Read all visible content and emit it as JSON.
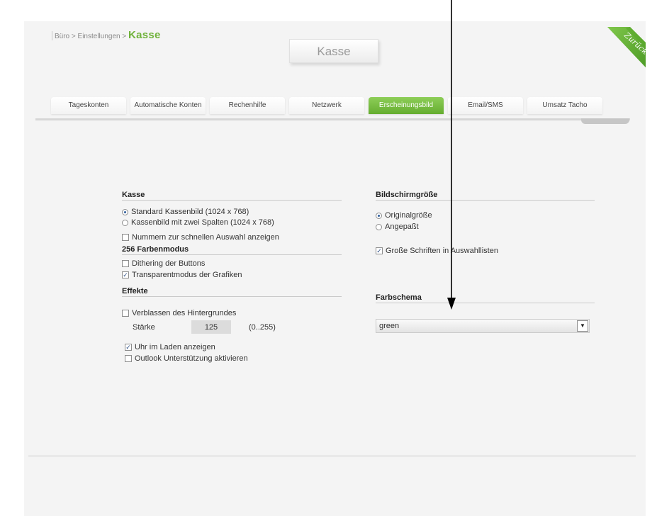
{
  "breadcrumb": {
    "path": "Büro > Einstellungen > ",
    "current": "Kasse"
  },
  "page_title": "Kasse",
  "back_label": "Zurück",
  "tabs": [
    {
      "label": "Tageskonten"
    },
    {
      "label": "Automatische Konten"
    },
    {
      "label": "Rechenhilfe"
    },
    {
      "label": "Netzwerk"
    },
    {
      "label": "Erscheinungsbild"
    },
    {
      "label": "Email/SMS"
    },
    {
      "label": "Umsatz Tacho"
    }
  ],
  "active_tab": "Erscheinungsbild",
  "kasse": {
    "title": "Kasse",
    "options": [
      {
        "label": "Standard Kassenbild (1024 x 768)",
        "selected": true
      },
      {
        "label": "Kassenbild mit zwei Spalten (1024 x 768)",
        "selected": false
      }
    ],
    "numbers": {
      "label": "Nummern zur schnellen Auswahl anzeigen",
      "checked": false
    }
  },
  "farbenmodus": {
    "title": "256 Farbenmodus",
    "dithering": {
      "label": "Dithering der Buttons",
      "checked": false
    },
    "transparent": {
      "label": "Transparentmodus der Grafiken",
      "checked": true
    }
  },
  "effekte": {
    "title": "Effekte",
    "fade": {
      "label": "Verblassen des Hintergrundes",
      "checked": false
    },
    "strength_label": "Stärke",
    "strength_value": "125",
    "strength_range": "(0..255)",
    "clock": {
      "label": "Uhr im Laden anzeigen",
      "checked": true
    },
    "outlook": {
      "label": "Outlook Unterstützung aktivieren",
      "checked": false
    }
  },
  "bildschirm": {
    "title": "Bildschirmgröße",
    "options": [
      {
        "label": "Originalgröße",
        "selected": true
      },
      {
        "label": "Angepaßt",
        "selected": false
      }
    ],
    "large_fonts": {
      "label": "Große Schriften in Auswahllisten",
      "checked": true
    }
  },
  "farbschema": {
    "title": "Farbschema",
    "value": "green"
  },
  "colors": {
    "accent": "#6fb23a",
    "tab_active": "#65ad30",
    "background": "#f4f4f4"
  }
}
